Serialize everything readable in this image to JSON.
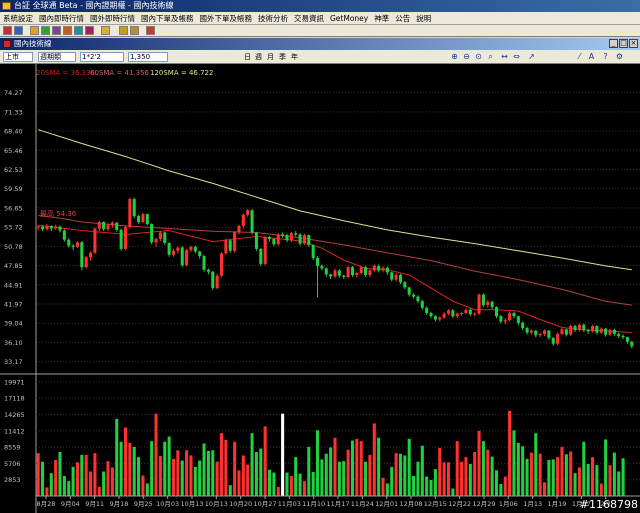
{
  "window": {
    "title": "台証 全球通 Beta - 國內證期權 - 國內技術線"
  },
  "menu": [
    "系統設定",
    "國內即時行情",
    "國外即時行情",
    "國內下單及帳務",
    "國外下單及帳務",
    "技術分析",
    "交易資訊",
    "GetMoney",
    "神準",
    "公告",
    "說明"
  ],
  "subwindow": {
    "title": "國內技術線",
    "minimize": "_",
    "restore": "□",
    "close": "×"
  },
  "chart_toolbar": {
    "market": "上市",
    "period": "週期類",
    "code": "1*2'2",
    "count": "1,350",
    "periods": [
      "日",
      "週",
      "月",
      "季",
      "年"
    ],
    "icons": [
      "zoom-in-icon",
      "zoom-out-icon",
      "fit-icon",
      "search-icon",
      "expand-icon",
      "shrink-icon",
      "cursor-icon",
      "draw-icon",
      "text-icon",
      "help-icon",
      "settings-icon"
    ]
  },
  "watermark": "#1168798",
  "chart_data": [
    {
      "type": "candlestick",
      "title": "",
      "legend": [
        {
          "name": "20SMA = 36.336",
          "color": "#cc2222"
        },
        {
          "name": "60SMA = 41.356",
          "color": "#c04a4a"
        },
        {
          "name": "120SMA = 46.722",
          "color": "#e0e090"
        }
      ],
      "high_label": "最高 54.36",
      "yticks": [
        33.17,
        36.1,
        39.04,
        41.97,
        44.91,
        47.85,
        50.78,
        53.72,
        56.65,
        59.59,
        62.53,
        65.46,
        68.4,
        71.33,
        74.27
      ],
      "ylim": [
        32.5,
        76.5
      ],
      "xlabels": [
        "8月28",
        "9月04",
        "9月11",
        "9月18",
        "9月25",
        "10月03",
        "10月13",
        "10月13",
        "10月20",
        "10月27",
        "11月03",
        "11月10",
        "11月17",
        "11月24",
        "12月01",
        "12月08",
        "12月15",
        "12月22",
        "12月29",
        "1月06",
        "1月13",
        "1月19",
        "1月27",
        "2月"
      ],
      "candles": [
        [
          53.7,
          53.8,
          53.2,
          54
        ],
        [
          53.8,
          53.4,
          53.1,
          54
        ],
        [
          53.4,
          53.9,
          53.2,
          54.2
        ],
        [
          53.9,
          53.5,
          53.1,
          54
        ],
        [
          53.5,
          53.8,
          53.3,
          54.1
        ],
        [
          53.8,
          53.2,
          52.9,
          54
        ],
        [
          53.2,
          51.8,
          51.5,
          53.4
        ],
        [
          51.8,
          50.9,
          50.6,
          52
        ],
        [
          50.9,
          50.7,
          50.2,
          51.1
        ],
        [
          50.7,
          51.4,
          50.5,
          51.6
        ],
        [
          51.4,
          47.6,
          47.1,
          51.6
        ],
        [
          47.6,
          49.1,
          47.4,
          49.3
        ],
        [
          49.1,
          49.8,
          48.6,
          50
        ],
        [
          49.8,
          53.5,
          49.6,
          53.7
        ],
        [
          53.5,
          54.5,
          53.1,
          54.7
        ],
        [
          54.5,
          53.4,
          53.1,
          54.6
        ],
        [
          53.4,
          54,
          53.1,
          54.3
        ],
        [
          54,
          54.4,
          53.6,
          54.6
        ],
        [
          54.4,
          53.3,
          53,
          54.5
        ],
        [
          53.3,
          50.4,
          50.1,
          53.5
        ],
        [
          50.4,
          53.7,
          50.2,
          53.9
        ],
        [
          53.7,
          58,
          53.5,
          58.2
        ],
        [
          58,
          55.4,
          55.1,
          58.2
        ],
        [
          55.4,
          54.5,
          54.2,
          55.6
        ],
        [
          54.5,
          55.7,
          54.3,
          55.9
        ],
        [
          55.7,
          54.2,
          54,
          55.8
        ],
        [
          54.2,
          51.4,
          51.1,
          54.3
        ],
        [
          51.4,
          51.9,
          50.7,
          52.1
        ],
        [
          51.9,
          52.9,
          51.6,
          53.1
        ],
        [
          52.9,
          51.3,
          51,
          53
        ],
        [
          51.3,
          49.5,
          49.2,
          51.4
        ],
        [
          49.5,
          50.1,
          49.2,
          50.4
        ],
        [
          50.1,
          50.6,
          49.7,
          50.8
        ],
        [
          50.6,
          47.9,
          47.6,
          50.8
        ],
        [
          47.9,
          50.2,
          47.7,
          50.4
        ],
        [
          50.2,
          50.7,
          49.9,
          50.9
        ],
        [
          50.7,
          50,
          49.7,
          50.9
        ],
        [
          50,
          49.3,
          48.9,
          50.1
        ],
        [
          49.3,
          47.2,
          46.9,
          49.5
        ],
        [
          47.2,
          46.9,
          46.5,
          47.4
        ],
        [
          46.9,
          44.4,
          44.1,
          47
        ],
        [
          44.4,
          46.3,
          44.2,
          46.6
        ],
        [
          46.3,
          49.7,
          46.1,
          49.9
        ],
        [
          49.7,
          51.7,
          49.5,
          51.9
        ],
        [
          51.7,
          50.1,
          49.8,
          51.8
        ],
        [
          50.1,
          52.9,
          49.8,
          53.1
        ],
        [
          52.9,
          53.9,
          52.6,
          54.1
        ],
        [
          53.9,
          55.6,
          53.5,
          55.8
        ],
        [
          55.6,
          56.3,
          55.3,
          56.5
        ],
        [
          56.3,
          52.9,
          52.6,
          56.5
        ],
        [
          52.9,
          50.4,
          50.1,
          53
        ],
        [
          50.4,
          48.1,
          47.8,
          50.5
        ],
        [
          48.1,
          52.2,
          47.9,
          52.4
        ],
        [
          52.2,
          51.9,
          51.5,
          52.4
        ],
        [
          51.9,
          51.1,
          50.8,
          52.1
        ],
        [
          51.1,
          52.6,
          50.9,
          52.8
        ],
        [
          52.6,
          52.5,
          52.1,
          52.9
        ],
        [
          52.5,
          51.7,
          51.4,
          52.7
        ],
        [
          51.7,
          52.8,
          51.4,
          53
        ],
        [
          52.8,
          52.6,
          52.3,
          53.1
        ],
        [
          52.6,
          51.2,
          50.9,
          52.8
        ],
        [
          51.2,
          52.5,
          51,
          52.7
        ],
        [
          52.5,
          51,
          50.7,
          52.6
        ],
        [
          51,
          49,
          48.7,
          51.1
        ],
        [
          49,
          47.8,
          43,
          49.3
        ],
        [
          47.8,
          47.4,
          47.1,
          48
        ],
        [
          47.4,
          46.5,
          46.1,
          47.6
        ],
        [
          46.5,
          46.2,
          45.8,
          46.6
        ],
        [
          46.2,
          47.1,
          45.9,
          47.4
        ],
        [
          47.1,
          46.3,
          46,
          47.3
        ],
        [
          46.3,
          46.1,
          45.8,
          46.4
        ],
        [
          46.1,
          47.6,
          45.9,
          47.8
        ],
        [
          47.6,
          46.4,
          46.1,
          47.8
        ],
        [
          46.4,
          46.7,
          46,
          46.9
        ],
        [
          46.7,
          47.6,
          46.5,
          47.8
        ],
        [
          47.6,
          46.4,
          46.1,
          47.8
        ],
        [
          46.4,
          47.1,
          46.1,
          47.3
        ],
        [
          47.1,
          47.8,
          46.9,
          48
        ],
        [
          47.8,
          47.1,
          46.8,
          48
        ],
        [
          47.1,
          47.5,
          46.8,
          47.7
        ],
        [
          47.5,
          46.8,
          46.4,
          47.7
        ],
        [
          46.8,
          45.7,
          45.4,
          46.9
        ],
        [
          45.7,
          46.4,
          45.4,
          46.7
        ],
        [
          46.4,
          45.3,
          45,
          46.6
        ],
        [
          45.3,
          44.5,
          44.2,
          45.5
        ],
        [
          44.5,
          43.4,
          43.1,
          44.6
        ],
        [
          43.4,
          43.1,
          42.8,
          43.6
        ],
        [
          43.1,
          42.4,
          42.1,
          43.3
        ],
        [
          42.4,
          41.4,
          41.1,
          42.6
        ],
        [
          41.4,
          40.6,
          40.3,
          41.6
        ],
        [
          40.6,
          40.1,
          39.8,
          40.8
        ],
        [
          40.1,
          39.6,
          39.3,
          40.3
        ],
        [
          39.6,
          39.9,
          39.3,
          40.1
        ],
        [
          39.9,
          40.5,
          39.7,
          40.7
        ],
        [
          40.5,
          41,
          40.3,
          41.2
        ],
        [
          41,
          40.1,
          39.8,
          41.2
        ],
        [
          40.1,
          40.5,
          39.8,
          40.7
        ],
        [
          40.5,
          40.6,
          40.2,
          40.8
        ],
        [
          40.6,
          41.1,
          40.4,
          41.3
        ],
        [
          41.1,
          40.4,
          40.1,
          41.3
        ],
        [
          40.4,
          40.5,
          40.1,
          40.7
        ],
        [
          40.5,
          43.4,
          40.3,
          43.6
        ],
        [
          43.4,
          41.8,
          41.5,
          43.6
        ],
        [
          41.8,
          42.3,
          41.4,
          42.6
        ],
        [
          42.3,
          41.5,
          41.2,
          42.5
        ],
        [
          41.5,
          40.1,
          39.8,
          41.6
        ],
        [
          40.1,
          39.3,
          39,
          40.3
        ],
        [
          39.3,
          39.5,
          38.9,
          39.8
        ],
        [
          39.5,
          40.6,
          39.3,
          40.8
        ],
        [
          40.6,
          40.1,
          39.8,
          40.8
        ],
        [
          40.1,
          39.1,
          38.7,
          40.2
        ],
        [
          39.1,
          38.3,
          38,
          39.3
        ],
        [
          38.3,
          37.6,
          37.3,
          38.5
        ],
        [
          37.6,
          37.9,
          37.3,
          38.1
        ],
        [
          37.9,
          37.2,
          36.9,
          38
        ],
        [
          37.2,
          37.4,
          36.9,
          37.6
        ],
        [
          37.4,
          37.9,
          37.1,
          38.1
        ],
        [
          37.9,
          36.8,
          36.5,
          38
        ],
        [
          36.8,
          35.9,
          35.6,
          36.9
        ],
        [
          35.9,
          37.4,
          35.7,
          37.6
        ],
        [
          37.4,
          38.1,
          37.2,
          38.3
        ],
        [
          38.1,
          37.3,
          37,
          38.2
        ],
        [
          37.3,
          38.6,
          37.1,
          38.8
        ],
        [
          38.6,
          38,
          37.7,
          38.8
        ],
        [
          38,
          38.8,
          37.8,
          39
        ],
        [
          38.8,
          38,
          37.7,
          39
        ],
        [
          38,
          37.8,
          37.4,
          38.2
        ],
        [
          37.8,
          38.6,
          37.6,
          38.8
        ],
        [
          38.6,
          37.6,
          37.3,
          38.7
        ],
        [
          37.6,
          38.2,
          37.4,
          38.4
        ],
        [
          38.2,
          37.3,
          37,
          38.3
        ],
        [
          37.3,
          38,
          37.1,
          38.2
        ],
        [
          38,
          37.4,
          37.1,
          38.2
        ],
        [
          37.4,
          37.1,
          36.8,
          37.6
        ],
        [
          37.1,
          36.9,
          36.6,
          37.3
        ],
        [
          36.9,
          36.2,
          35.9,
          37
        ],
        [
          36.2,
          35.5,
          35.2,
          36.3
        ]
      ],
      "sma20": [
        [
          0,
          54
        ],
        [
          10,
          53.2
        ],
        [
          20,
          52.6
        ],
        [
          30,
          53.2
        ],
        [
          40,
          51.5
        ],
        [
          50,
          52.3
        ],
        [
          60,
          51.6
        ],
        [
          65,
          50.5
        ],
        [
          70,
          48.7
        ],
        [
          75,
          47.4
        ],
        [
          80,
          47.2
        ],
        [
          85,
          46.4
        ],
        [
          90,
          44.4
        ],
        [
          95,
          42.4
        ],
        [
          100,
          41.1
        ],
        [
          105,
          41.1
        ],
        [
          110,
          40.9
        ],
        [
          115,
          39.6
        ],
        [
          120,
          38.4
        ],
        [
          125,
          38
        ],
        [
          130,
          37.9
        ],
        [
          136,
          37.6
        ]
      ],
      "sma60": [
        [
          0,
          55.5
        ],
        [
          5,
          55.1
        ],
        [
          10,
          54.5
        ],
        [
          20,
          53.9
        ],
        [
          30,
          53.5
        ],
        [
          40,
          53.1
        ],
        [
          50,
          52.9
        ],
        [
          60,
          52.1
        ],
        [
          70,
          51
        ],
        [
          80,
          49.8
        ],
        [
          90,
          48.6
        ],
        [
          100,
          47
        ],
        [
          110,
          45.7
        ],
        [
          120,
          44.2
        ],
        [
          130,
          42.4
        ],
        [
          136,
          41.8
        ]
      ],
      "sma120": [
        [
          0,
          68.6
        ],
        [
          10,
          66.5
        ],
        [
          20,
          64.5
        ],
        [
          30,
          62.3
        ],
        [
          40,
          60.4
        ],
        [
          50,
          58.3
        ],
        [
          60,
          56.2
        ],
        [
          70,
          54.7
        ],
        [
          80,
          53.3
        ],
        [
          90,
          52.2
        ],
        [
          100,
          51.2
        ],
        [
          110,
          50.1
        ],
        [
          120,
          49
        ],
        [
          130,
          47.8
        ],
        [
          136,
          47.2
        ]
      ]
    },
    {
      "type": "bar",
      "title": "",
      "yticks": [
        2853,
        5706,
        8559,
        11412,
        14265,
        17118,
        19971
      ],
      "ylim": [
        0,
        21000
      ],
      "values": [
        7500,
        6000,
        1500,
        4000,
        6300,
        7700,
        3500,
        2600,
        5100,
        5900,
        7200,
        7200,
        4300,
        7500,
        1600,
        4300,
        6100,
        5000,
        13500,
        9500,
        12000,
        9300,
        8600,
        6800,
        3600,
        2200,
        9600,
        14400,
        7000,
        9500,
        10400,
        6500,
        8000,
        6200,
        8000,
        7100,
        5100,
        6200,
        9200,
        7900,
        8000,
        6000,
        11000,
        9800,
        1900,
        9500,
        4500,
        7100,
        5500,
        11000,
        7700,
        8300,
        12200,
        4600,
        4100,
        1600,
        14400,
        4100,
        3500,
        6800,
        3900,
        2600,
        8600,
        4200,
        11500,
        6400,
        7400,
        8500,
        10200,
        6000,
        6100,
        8100,
        9700,
        10000,
        9600,
        6000,
        7200,
        12700,
        10200,
        3200,
        2200,
        5100,
        7500,
        7400,
        7100,
        10000,
        3500,
        6000,
        8800,
        3400,
        2800,
        4700,
        8400,
        5900,
        5900,
        1300,
        9600,
        6000,
        6800,
        5600,
        7700,
        11400,
        9600,
        8100,
        6900,
        4500,
        2100,
        3400,
        14900,
        11500,
        9300,
        8700,
        6500,
        7600,
        11000,
        7400,
        2400,
        6300,
        6400,
        6800,
        8600,
        7300,
        7800,
        4000,
        5000,
        9500,
        5600,
        6800,
        5400,
        2200,
        9900,
        5400,
        7600,
        4300,
        6600
      ]
    }
  ]
}
